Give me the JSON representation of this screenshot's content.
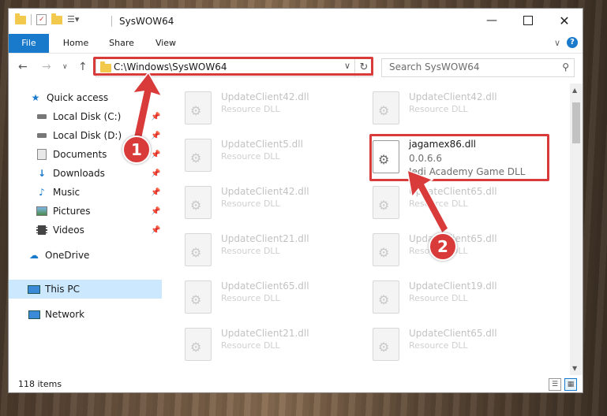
{
  "window": {
    "title": "SysWOW64",
    "minimize_icon": "minimize-icon",
    "maximize_icon": "maximize-icon",
    "close_icon": "close-icon"
  },
  "ribbon": {
    "tabs": [
      {
        "label": "File"
      },
      {
        "label": "Home"
      },
      {
        "label": "Share"
      },
      {
        "label": "View"
      }
    ]
  },
  "address": {
    "path": "C:\\Windows\\SysWOW64"
  },
  "search": {
    "placeholder": "Search SysWOW64"
  },
  "sidebar": {
    "items": [
      {
        "label": "Quick access",
        "icon": "star-icon",
        "pinned": false
      },
      {
        "label": "Local Disk (C:)",
        "icon": "drive-icon",
        "pinned": true
      },
      {
        "label": "Local Disk (D:)",
        "icon": "drive-icon",
        "pinned": true
      },
      {
        "label": "Documents",
        "icon": "documents-icon",
        "pinned": true
      },
      {
        "label": "Downloads",
        "icon": "downloads-icon",
        "pinned": true
      },
      {
        "label": "Music",
        "icon": "music-icon",
        "pinned": true
      },
      {
        "label": "Pictures",
        "icon": "pictures-icon",
        "pinned": true
      },
      {
        "label": "Videos",
        "icon": "videos-icon",
        "pinned": true
      },
      {
        "label": "OneDrive",
        "icon": "cloud-icon",
        "pinned": false
      },
      {
        "label": "This PC",
        "icon": "computer-icon",
        "pinned": false,
        "selected": true
      },
      {
        "label": "Network",
        "icon": "network-icon",
        "pinned": false
      }
    ]
  },
  "files": [
    {
      "name": "UpdateClient42.dll",
      "desc": "Resource DLL"
    },
    {
      "name": "UpdateClient42.dll",
      "desc": "Resource DLL"
    },
    {
      "name": "UpdateClient5.dll",
      "desc": "Resource DLL"
    },
    {
      "name": "jagamex86.dll",
      "version": "0.0.6.6",
      "desc": "Jedi Academy Game DLL",
      "highlighted": true
    },
    {
      "name": "UpdateClient42.dll",
      "desc": "Resource DLL"
    },
    {
      "name": "UpdateClient65.dll",
      "desc": "Resource DLL"
    },
    {
      "name": "UpdateClient21.dll",
      "desc": "Resource DLL"
    },
    {
      "name": "UpdateClient65.dll",
      "desc": "Resource DLL"
    },
    {
      "name": "UpdateClient65.dll",
      "desc": "Resource DLL"
    },
    {
      "name": "UpdateClient19.dll",
      "desc": "Resource DLL"
    },
    {
      "name": "UpdateClient21.dll",
      "desc": "Resource DLL"
    },
    {
      "name": "UpdateClient65.dll",
      "desc": "Resource DLL"
    }
  ],
  "status": {
    "item_count": "118 items"
  },
  "annotations": {
    "step1": "1",
    "step2": "2",
    "color": "#d93a3a"
  },
  "colors": {
    "accent": "#1979ca",
    "selection": "#cce8ff"
  }
}
